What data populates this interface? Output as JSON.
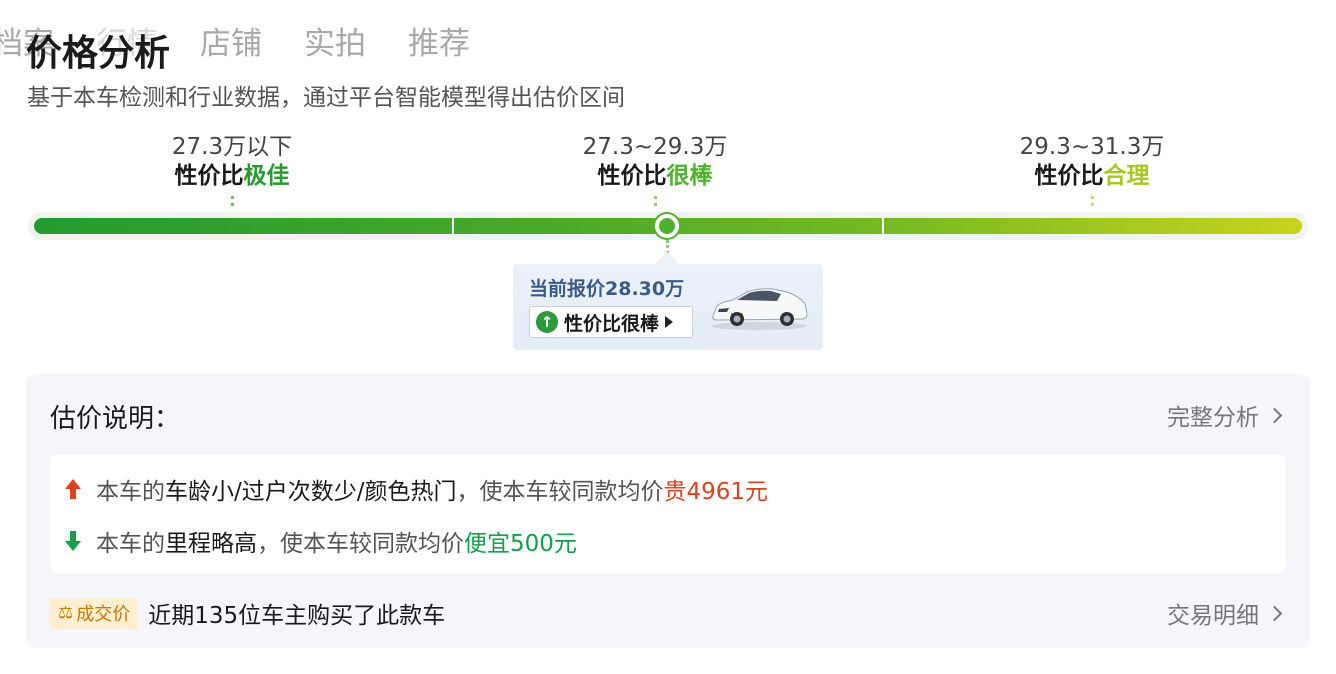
{
  "tabs": [
    "档案",
    "行情",
    "店铺",
    "实拍",
    "推荐"
  ],
  "title": "价格分析",
  "subtitle": "基于本车检测和行业数据，通过平台智能模型得出估价区间",
  "ranges": [
    {
      "price": "27.3万以下",
      "prefix": "性价比",
      "highlight": "极佳"
    },
    {
      "price": "27.3~29.3万",
      "prefix": "性价比",
      "highlight": "很棒"
    },
    {
      "price": "29.3~31.3万",
      "prefix": "性价比",
      "highlight": "合理"
    }
  ],
  "current": {
    "label": "当前报价28.30万",
    "button": "性价比很棒",
    "car_icon": "car-thumbnail"
  },
  "colors": {
    "excellent": "#2a9a2e",
    "great": "#4fb12e",
    "reasonable": "#a8c81c",
    "up": "#e0401d",
    "down": "#12a04a"
  },
  "explain": {
    "title": "估价说明：",
    "link": "完整分析",
    "items": [
      {
        "direction": "up",
        "pre": "本车的",
        "factor": "车龄小/过户次数少/颜色热门",
        "mid": "，使本车较同款均价",
        "effect": "贵4961元"
      },
      {
        "direction": "down",
        "pre": "本车的",
        "factor": "里程略高",
        "mid": "，使本车较同款均价",
        "effect": "便宜500元"
      }
    ]
  },
  "deal": {
    "badge": "成交价",
    "text": "近期135位车主购买了此款车",
    "link": "交易明细"
  }
}
